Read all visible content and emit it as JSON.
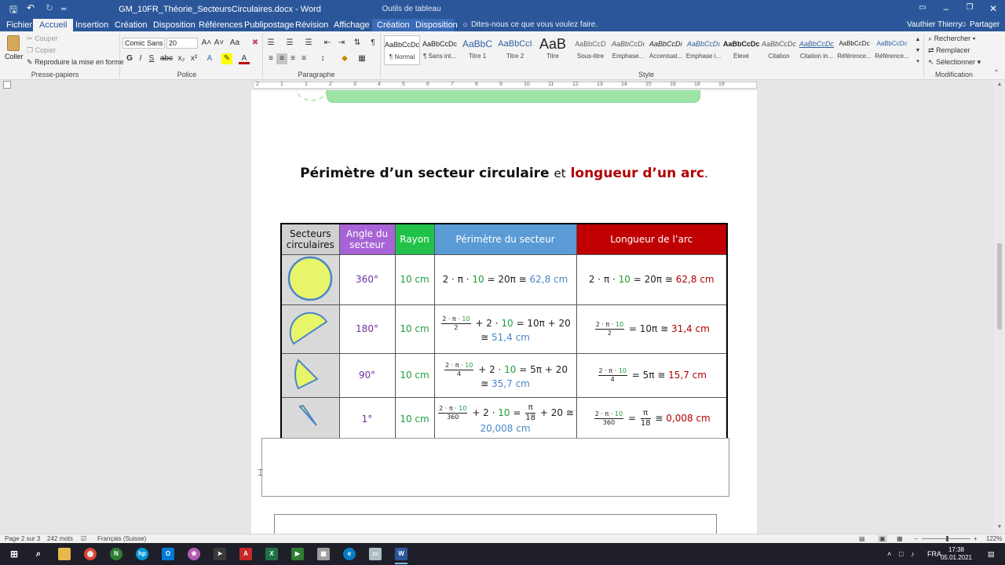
{
  "titlebar": {
    "doc_title": "GM_10FR_Théorie_SecteursCirculaires.docx - Word",
    "context_tools": "Outils de tableau"
  },
  "tabs": {
    "file": "Fichier",
    "home": "Accueil",
    "insert": "Insertion",
    "design": "Création",
    "layout": "Disposition",
    "references": "Références",
    "mailings": "Publipostage",
    "review": "Révision",
    "view": "Affichage",
    "table_design": "Création",
    "table_layout": "Disposition",
    "tell_me": "Dites-nous ce que vous voulez faire.",
    "user": "Vauthier Thierry",
    "share": "Partager"
  },
  "ribbon": {
    "clipboard": {
      "paste": "Coller",
      "cut": "Couper",
      "copy": "Copier",
      "format_painter": "Reproduire la mise en forme",
      "label": "Presse-papiers"
    },
    "font": {
      "name": "Comic Sans I",
      "size": "20",
      "label": "Police"
    },
    "paragraph": {
      "label": "Paragraphe"
    },
    "styles": {
      "label": "Style",
      "items": [
        {
          "preview": "AaBbCcDc",
          "name": "¶ Normal"
        },
        {
          "preview": "AaBbCcDc",
          "name": "¶ Sans int..."
        },
        {
          "preview": "AaBbC",
          "name": "Titre 1"
        },
        {
          "preview": "AaBbCcI",
          "name": "Titre 2"
        },
        {
          "preview": "AaB",
          "name": "Titre"
        },
        {
          "preview": "AaBbCcD",
          "name": "Sous-titre"
        },
        {
          "preview": "AaBbCcDı",
          "name": "Emphase..."
        },
        {
          "preview": "AaBbCcDı",
          "name": "Accentuat..."
        },
        {
          "preview": "AaBbCcDı",
          "name": "Emphase i..."
        },
        {
          "preview": "AaBbCcDc",
          "name": "Élevé"
        },
        {
          "preview": "AaBbCcDc",
          "name": "Citation"
        },
        {
          "preview": "AaBbCcDc",
          "name": "Citation in..."
        },
        {
          "preview": "AaBbCcDc",
          "name": "Référence..."
        },
        {
          "preview": "AaBbCcDc",
          "name": "Référence..."
        }
      ]
    },
    "editing": {
      "find": "Rechercher",
      "replace": "Remplacer",
      "select": "Sélectionner",
      "label": "Modification"
    }
  },
  "ruler_numbers": [
    "2",
    "1",
    "1",
    "2",
    "3",
    "4",
    "5",
    "6",
    "7",
    "8",
    "9",
    "10",
    "11",
    "12",
    "13",
    "14",
    "15",
    "16",
    "18",
    "19"
  ],
  "document": {
    "heading_bold": "Périmètre d’un secteur circulaire",
    "heading_mid": "et",
    "heading_red": "longueur d’un arc",
    "heading_end": ".",
    "table": {
      "headers": {
        "sectors": "Secteurs circulaires",
        "angle": "Angle du secteur",
        "radius": "Rayon",
        "perimeter": "Périmètre du secteur",
        "arc": "Longueur de l’arc"
      },
      "rows": [
        {
          "angle": "360°",
          "radius": "10 cm",
          "per_a": "2 · π ·",
          "per_g": "10",
          "per_b": "= 20π ≅",
          "per_res": "62,8 cm",
          "arc_a": "2 · π ·",
          "arc_g": "10",
          "arc_b": "= 20π ≅",
          "arc_res": "62,8 cm"
        },
        {
          "angle": "180°",
          "radius": "10 cm",
          "frac_top_a": "2 · π ·",
          "frac_top_g": "10",
          "frac_bot": "2",
          "per_mid_a": "+ 2 ·",
          "per_mid_g": "10",
          "per_mid_b": "= 10π + 20",
          "per_line2": "≅",
          "per_res": "51,4 cm",
          "arc_b": "= 10π ≅",
          "arc_res": "31,4 cm"
        },
        {
          "angle": "90°",
          "radius": "10 cm",
          "frac_top_a": "2 · π ·",
          "frac_top_g": "10",
          "frac_bot": "4",
          "per_mid_a": "+ 2 ·",
          "per_mid_g": "10",
          "per_mid_b": "= 5π + 20",
          "per_line2": "≅",
          "per_res": "35,7 cm",
          "arc_b": "= 5π ≅",
          "arc_res": "15,7 cm"
        },
        {
          "angle": "1°",
          "radius": "10 cm",
          "frac_top_a": "2 · π ·",
          "frac_top_g": "10",
          "frac_bot": "360",
          "per_mid_a": "+ 2 ·",
          "per_mid_g": "10",
          "per_mid_b": "=",
          "pi_top": "π",
          "pi_bot": "18",
          "per_mid_c": "+ 20 ≅",
          "per_res": "20,008 cm",
          "arc_b": "=",
          "arc_c": "≅",
          "arc_res": "0,008 cm"
        }
      ]
    }
  },
  "statusbar": {
    "page": "Page 2 sur 3",
    "words": "242 mots",
    "language": "Français (Suisse)",
    "zoom": "122%"
  },
  "taskbar": {
    "language": "FRA",
    "time": "17:38",
    "date": "05.01.2021"
  }
}
